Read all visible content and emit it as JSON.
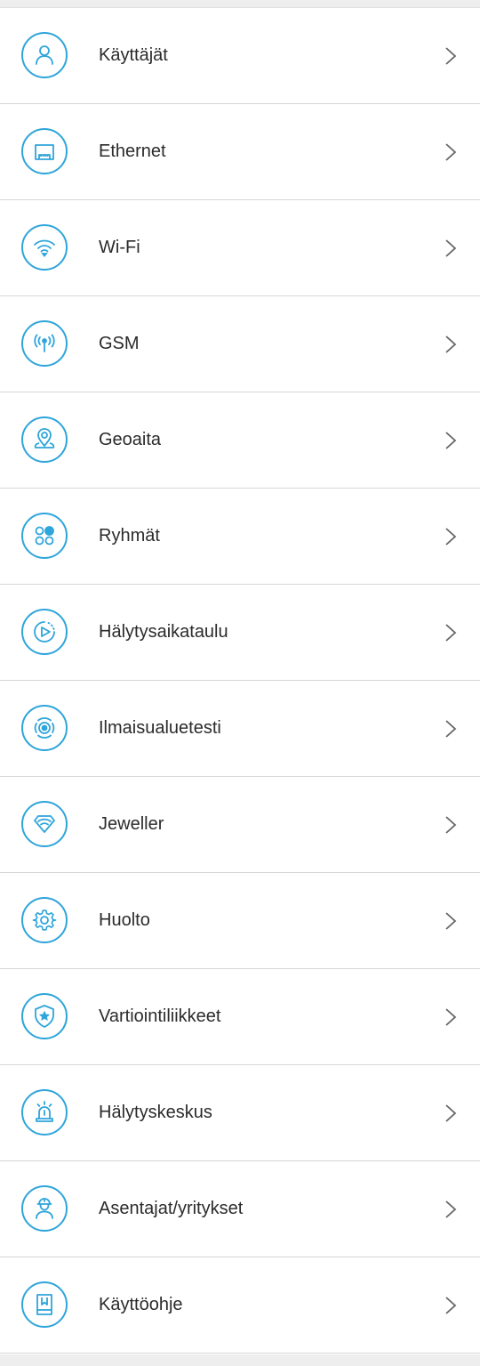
{
  "accent_color": "#2ea5db",
  "menu": {
    "items": [
      {
        "label": "Käyttäjät",
        "icon": "user-icon"
      },
      {
        "label": "Ethernet",
        "icon": "ethernet-icon"
      },
      {
        "label": "Wi-Fi",
        "icon": "wifi-icon"
      },
      {
        "label": "GSM",
        "icon": "antenna-icon"
      },
      {
        "label": "Geoaita",
        "icon": "location-pin-icon"
      },
      {
        "label": "Ryhmät",
        "icon": "groups-icon"
      },
      {
        "label": "Hälytysaikataulu",
        "icon": "schedule-play-icon"
      },
      {
        "label": "Ilmaisualuetesti",
        "icon": "detection-zone-icon"
      },
      {
        "label": "Jeweller",
        "icon": "jeweller-signal-icon"
      },
      {
        "label": "Huolto",
        "icon": "gear-icon"
      },
      {
        "label": "Vartiointiliikkeet",
        "icon": "shield-star-icon"
      },
      {
        "label": "Hälytyskeskus",
        "icon": "alarm-siren-icon"
      },
      {
        "label": "Asentajat/yritykset",
        "icon": "installer-icon"
      },
      {
        "label": "Käyttöohje",
        "icon": "manual-book-icon"
      }
    ]
  }
}
